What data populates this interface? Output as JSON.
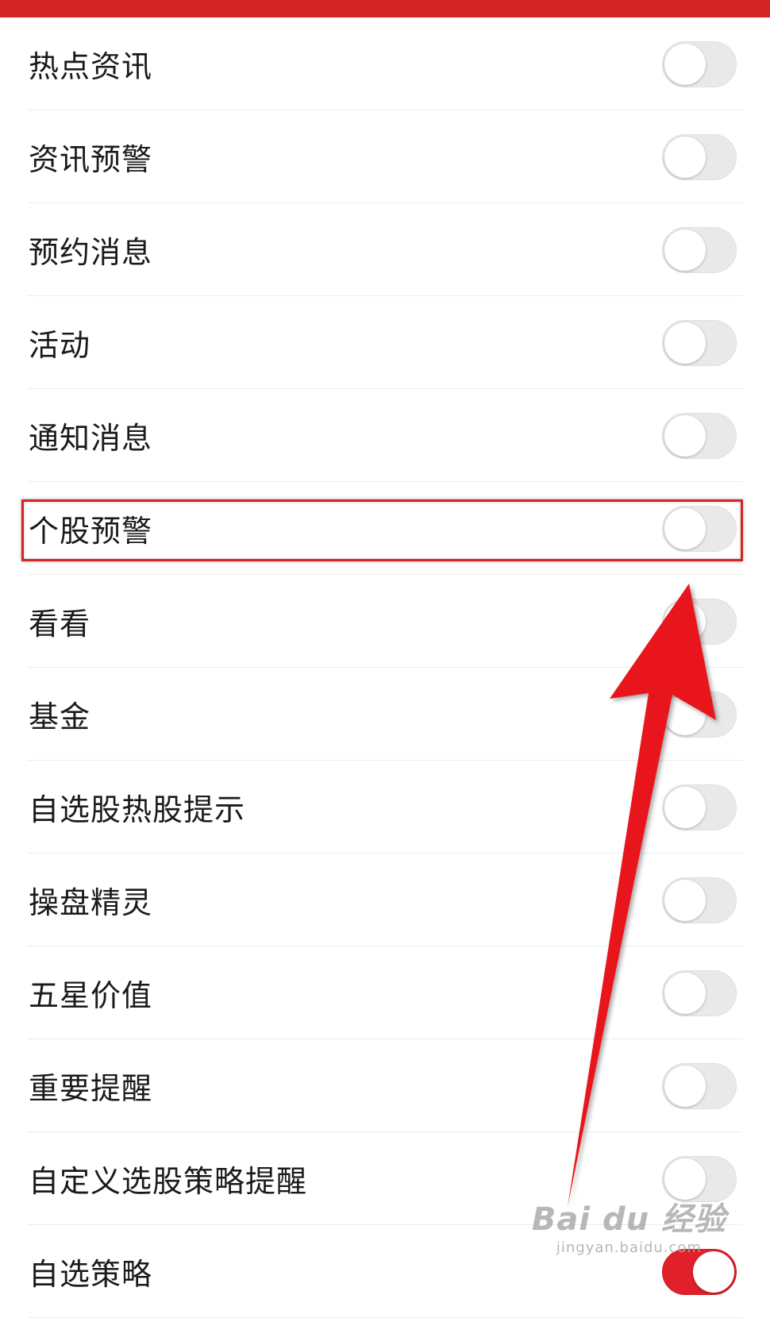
{
  "header": {
    "accent_color": "#d42424"
  },
  "settings": {
    "items": [
      {
        "label": "热点资讯",
        "enabled": false
      },
      {
        "label": "资讯预警",
        "enabled": false
      },
      {
        "label": "预约消息",
        "enabled": false
      },
      {
        "label": "活动",
        "enabled": false
      },
      {
        "label": "通知消息",
        "enabled": false
      },
      {
        "label": "个股预警",
        "enabled": false,
        "highlighted": true
      },
      {
        "label": "看看",
        "enabled": false
      },
      {
        "label": "基金",
        "enabled": false
      },
      {
        "label": "自选股热股提示",
        "enabled": false
      },
      {
        "label": "操盘精灵",
        "enabled": false
      },
      {
        "label": "五星价值",
        "enabled": false
      },
      {
        "label": "重要提醒",
        "enabled": false
      },
      {
        "label": "自定义选股策略提醒",
        "enabled": false
      },
      {
        "label": "自选策略",
        "enabled": true
      }
    ]
  },
  "annotation": {
    "arrow_color": "#e8141c",
    "highlight_color": "#d42424"
  },
  "watermark": {
    "brand": "Bai du 经验",
    "url": "jingyan.baidu.com"
  }
}
